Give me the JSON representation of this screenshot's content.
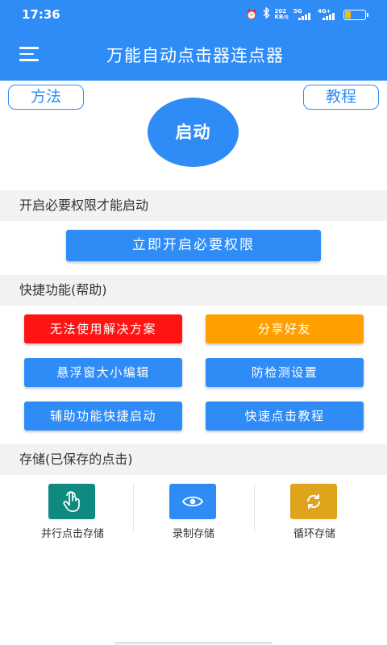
{
  "status_bar": {
    "time": "17:36",
    "alarm_icon": "alarm-clock-icon",
    "bluetooth_icon": "bluetooth-icon",
    "speed_value": "202",
    "speed_unit": "KB/s",
    "network_5g": "5G",
    "network_4g": "4G+",
    "battery_level": 0.25,
    "battery_color": "#f6c200"
  },
  "app_bar": {
    "menu_icon": "hamburger-menu-icon",
    "title": "万能自动点击器连点器",
    "background": "#2f8cf7"
  },
  "hero": {
    "method_label": "方法",
    "tutorial_label": "教程",
    "start_label": "启动"
  },
  "permission": {
    "header": "开启必要权限才能启动",
    "button_label": "立即开启必要权限"
  },
  "quick": {
    "header": "快捷功能(帮助)",
    "buttons": [
      {
        "label": "无法使用解决方案",
        "color": "#ff1414"
      },
      {
        "label": "分享好友",
        "color": "#ffa000"
      },
      {
        "label": "悬浮窗大小编辑",
        "color": "#2f8cf7"
      },
      {
        "label": "防检测设置",
        "color": "#2f8cf7"
      },
      {
        "label": "辅助功能快捷启动",
        "color": "#2f8cf7"
      },
      {
        "label": "快速点击教程",
        "color": "#2f8cf7"
      }
    ]
  },
  "storage": {
    "header": "存储(已保存的点击)",
    "items": [
      {
        "label": "并行点击存储",
        "icon": "touch-hand-icon",
        "color": "#0f8a80"
      },
      {
        "label": "录制存储",
        "icon": "eye-record-icon",
        "color": "#2f8cf7"
      },
      {
        "label": "循环存储",
        "icon": "loop-arrows-icon",
        "color": "#e0a41c"
      }
    ]
  }
}
